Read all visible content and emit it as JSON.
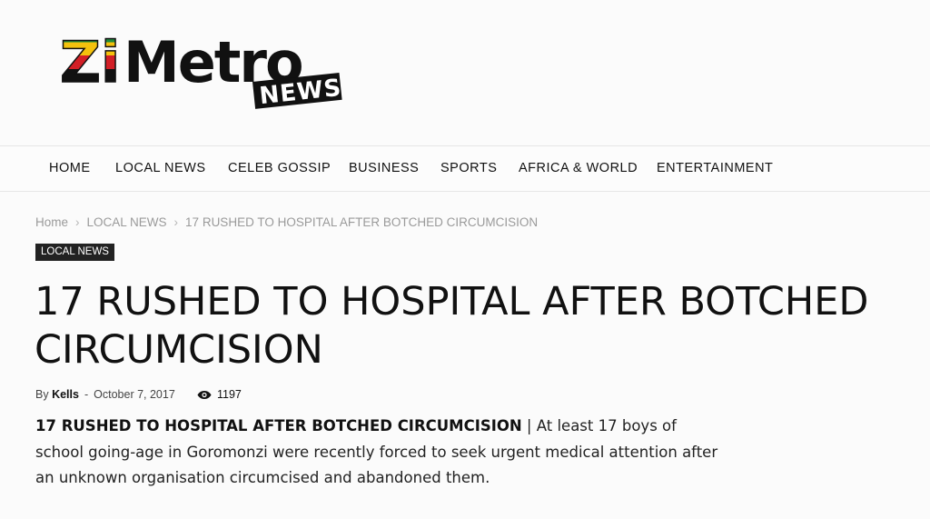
{
  "site": {
    "logo_text_main": "ZiMetro",
    "logo_text_sub": "NEWS"
  },
  "nav": {
    "items": [
      {
        "label": "HOME"
      },
      {
        "label": "LOCAL NEWS"
      },
      {
        "label": "CELEB GOSSIP"
      },
      {
        "label": "BUSINESS"
      },
      {
        "label": "SPORTS"
      },
      {
        "label": "AFRICA & WORLD"
      },
      {
        "label": "ENTERTAINMENT"
      }
    ]
  },
  "breadcrumb": {
    "home": "Home",
    "category": "LOCAL NEWS",
    "current": "17 RUSHED TO HOSPITAL AFTER BOTCHED CIRCUMCISION",
    "separator": "›"
  },
  "article": {
    "category_badge": "LOCAL NEWS",
    "title": "17 RUSHED TO HOSPITAL AFTER BOTCHED CIRCUMCISION",
    "by_label": "By",
    "author": "Kells",
    "dash": "-",
    "date": "October 7, 2017",
    "views_icon": "eye-icon",
    "views": "1197",
    "excerpt_bold": "17 RUSHED TO HOSPITAL AFTER BOTCHED CIRCUMCISION",
    "excerpt_sep": " | ",
    "excerpt_text": "At least 17 boys of school going-age in Goromonzi were recently forced to seek urgent medical attention after an unknown organisation circumcised and abandoned them."
  },
  "colors": {
    "zim_green": "#1f8a3a",
    "zim_yellow": "#f4c20d",
    "zim_red": "#d21f26",
    "zim_black": "#111111"
  }
}
